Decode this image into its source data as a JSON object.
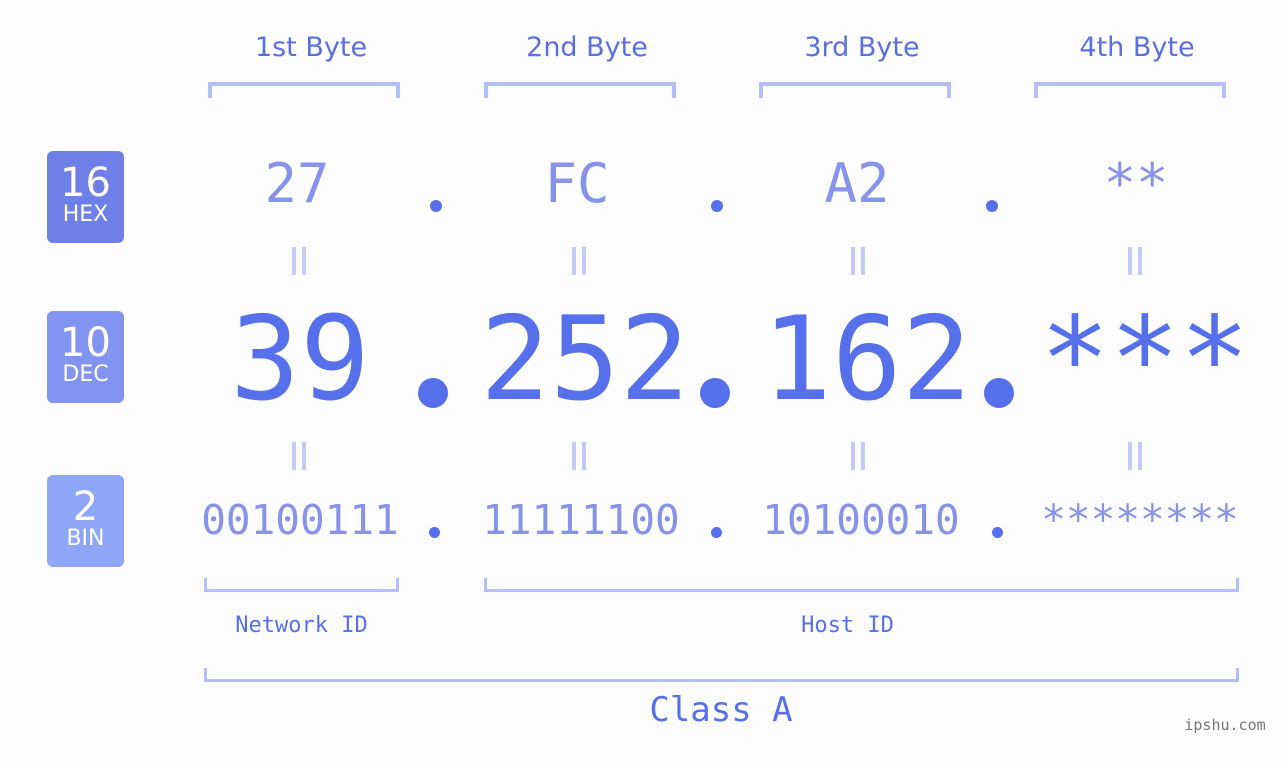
{
  "byte_headers": [
    "1st Byte",
    "2nd Byte",
    "3rd Byte",
    "4th Byte"
  ],
  "badges": {
    "hex": {
      "number": "16",
      "label": "HEX",
      "color": "#6f7fe8"
    },
    "dec": {
      "number": "10",
      "label": "DEC",
      "color": "#8293f0"
    },
    "bin": {
      "number": "2",
      "label": "BIN",
      "color": "#8ea6f8"
    }
  },
  "hex_values": [
    "27",
    "FC",
    "A2",
    "**"
  ],
  "dec_values": [
    "39",
    "252",
    "162",
    "***"
  ],
  "bin_values": [
    "00100111",
    "11111100",
    "10100010",
    "********"
  ],
  "separator": ".",
  "network_id_label": "Network ID",
  "host_id_label": "Host ID",
  "class_label": "Class A",
  "watermark": "ipshu.com",
  "colors": {
    "accent": "#5570ea",
    "light_accent": "#8792ea",
    "bracket": "#b4bef7",
    "background": "#fcfdfc"
  }
}
